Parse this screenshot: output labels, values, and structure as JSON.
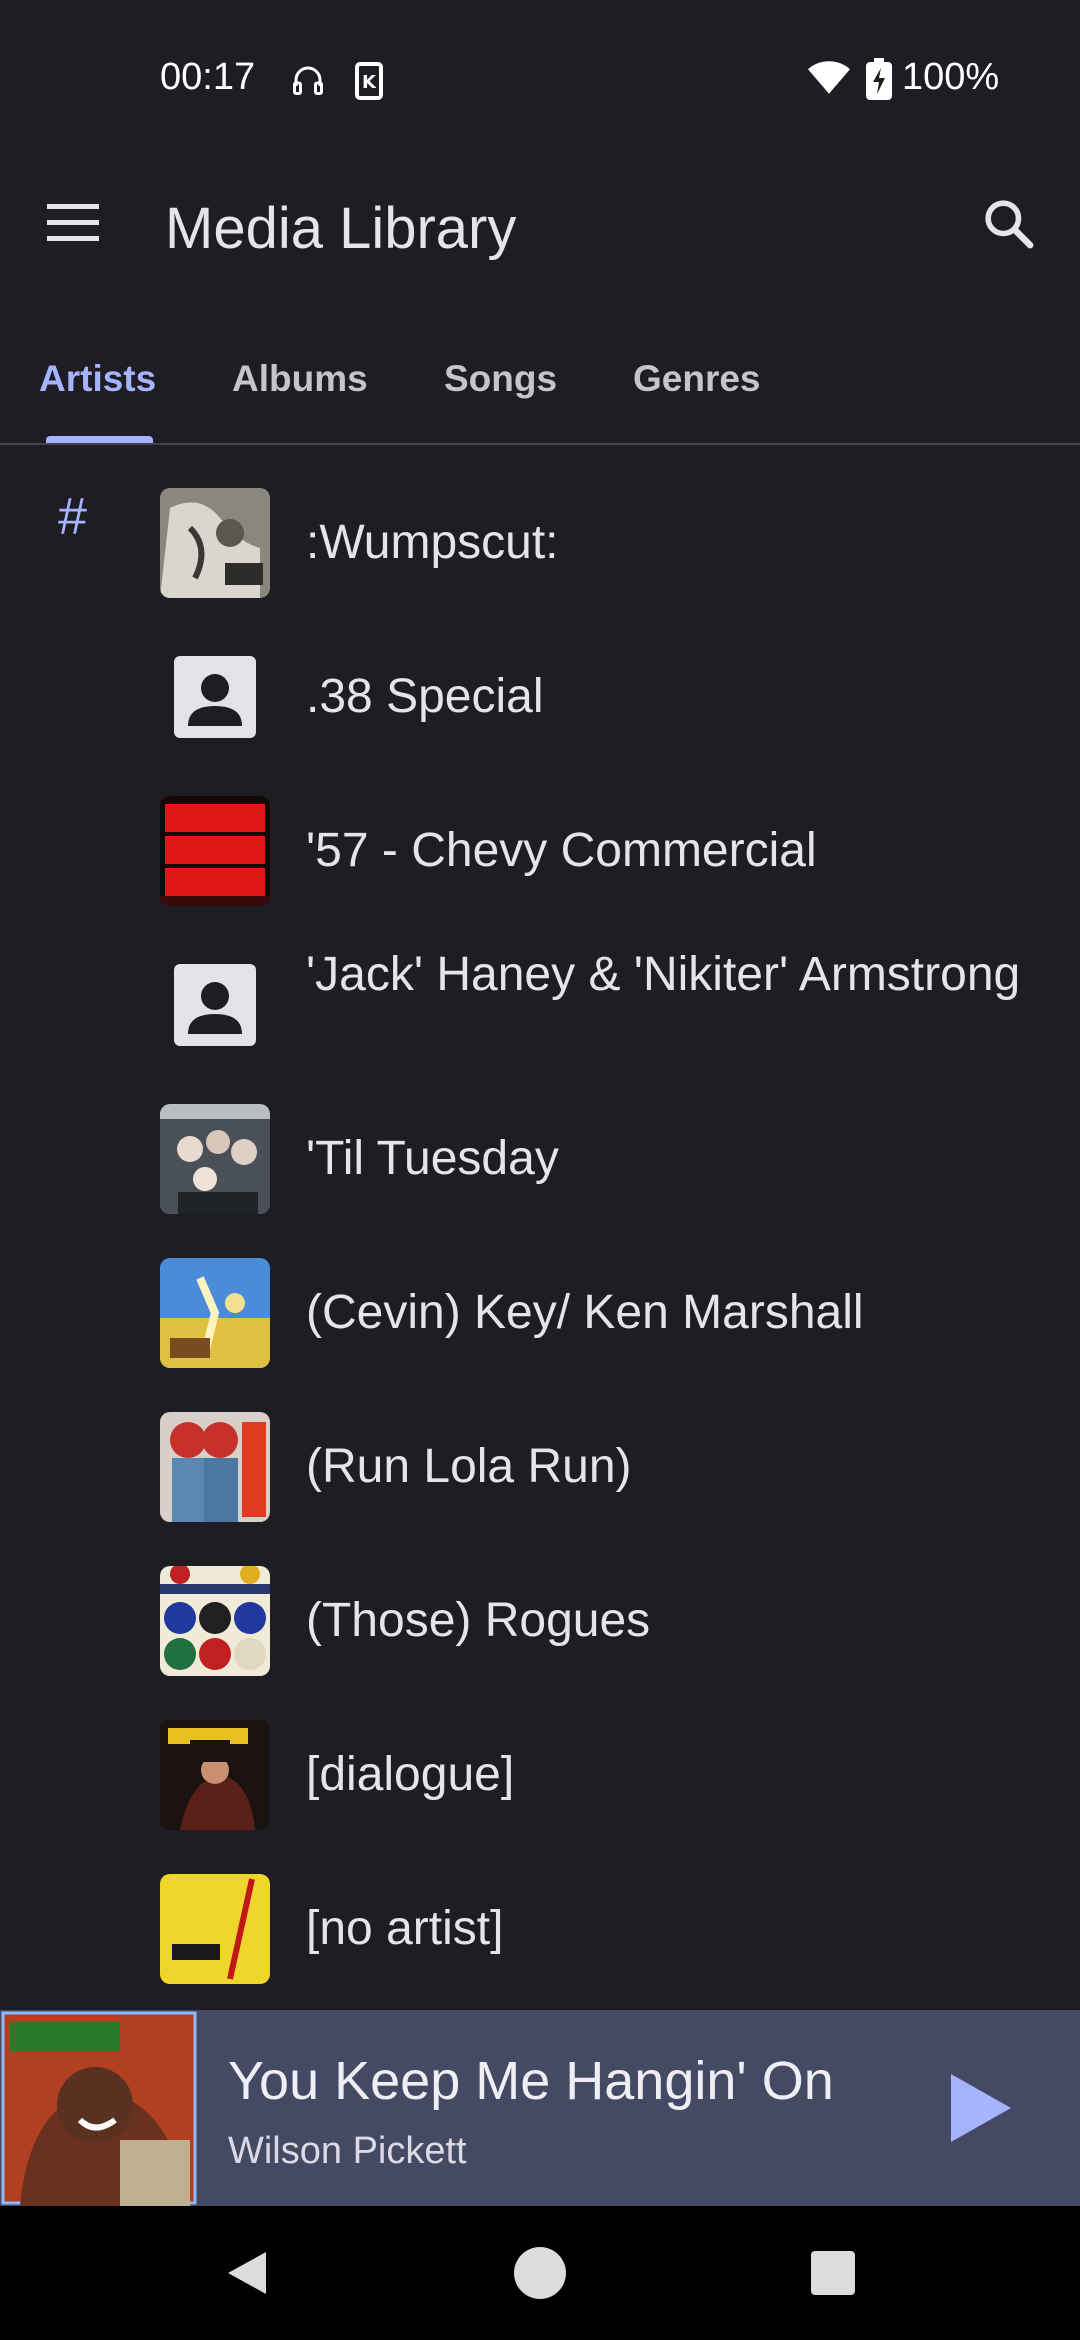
{
  "status": {
    "time": "00:17",
    "battery": "100%",
    "icons": [
      "headphones-icon",
      "k-app-icon",
      "wifi-icon",
      "battery-charging-icon"
    ]
  },
  "app_bar": {
    "title": "Media Library",
    "menu_icon": "hamburger-menu-icon",
    "search_icon": "search-icon"
  },
  "tabs": [
    {
      "label": "Artists",
      "active": true
    },
    {
      "label": "Albums",
      "active": false
    },
    {
      "label": "Songs",
      "active": false
    },
    {
      "label": "Genres",
      "active": false
    }
  ],
  "list": {
    "section_letter": "#",
    "items": [
      {
        "name": ":Wumpscut:",
        "thumb": "album-art"
      },
      {
        "name": ".38 Special",
        "thumb": "person-placeholder-icon"
      },
      {
        "name": "'57 - Chevy Commercial",
        "thumb": "album-art"
      },
      {
        "name": "'Jack' Haney & 'Nikiter' Armstrong",
        "thumb": "person-placeholder-icon"
      },
      {
        "name": "'Til Tuesday",
        "thumb": "album-art"
      },
      {
        "name": "(Cevin) Key/ Ken Marshall",
        "thumb": "album-art"
      },
      {
        "name": "(Run Lola Run)",
        "thumb": "album-art"
      },
      {
        "name": "(Those) Rogues",
        "thumb": "album-art"
      },
      {
        "name": "[dialogue]",
        "thumb": "album-art"
      },
      {
        "name": "[no artist]",
        "thumb": "album-art"
      }
    ]
  },
  "now_playing": {
    "title": "You Keep Me Hangin' On",
    "artist": "Wilson Pickett",
    "play_icon": "play-icon"
  },
  "colors": {
    "background": "#1e1d23",
    "accent": "#a6b4ff",
    "now_playing_bg": "#444a63"
  }
}
